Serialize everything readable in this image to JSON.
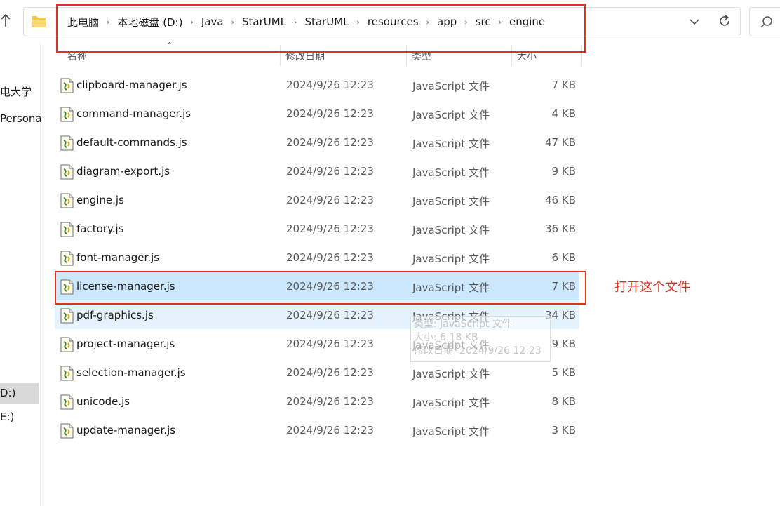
{
  "address_bar": {
    "breadcrumbs": [
      "此电脑",
      "本地磁盘 (D:)",
      "Java",
      "StarUML",
      "StarUML",
      "resources",
      "app",
      "src",
      "engine"
    ]
  },
  "nav": {
    "items": [
      {
        "label": "电大学",
        "selected": false
      },
      {
        "label": "Persona",
        "selected": false
      },
      {
        "label": "D:)",
        "selected": true
      },
      {
        "label": "E:)",
        "selected": false
      }
    ]
  },
  "columns": {
    "name": "名称",
    "date": "修改日期",
    "type": "类型",
    "size": "大小"
  },
  "files": [
    {
      "name": "clipboard-manager.js",
      "date": "2024/9/26 12:23",
      "type": "JavaScript 文件",
      "size": "7 KB"
    },
    {
      "name": "command-manager.js",
      "date": "2024/9/26 12:23",
      "type": "JavaScript 文件",
      "size": "4 KB"
    },
    {
      "name": "default-commands.js",
      "date": "2024/9/26 12:23",
      "type": "JavaScript 文件",
      "size": "47 KB"
    },
    {
      "name": "diagram-export.js",
      "date": "2024/9/26 12:23",
      "type": "JavaScript 文件",
      "size": "9 KB"
    },
    {
      "name": "engine.js",
      "date": "2024/9/26 12:23",
      "type": "JavaScript 文件",
      "size": "46 KB"
    },
    {
      "name": "factory.js",
      "date": "2024/9/26 12:23",
      "type": "JavaScript 文件",
      "size": "36 KB"
    },
    {
      "name": "font-manager.js",
      "date": "2024/9/26 12:23",
      "type": "JavaScript 文件",
      "size": "6 KB"
    },
    {
      "name": "license-manager.js",
      "date": "2024/9/26 12:23",
      "type": "JavaScript 文件",
      "size": "7 KB",
      "state": "selected"
    },
    {
      "name": "pdf-graphics.js",
      "date": "2024/9/26 12:23",
      "type": "JavaScript 文件",
      "size": "34 KB",
      "state": "hover"
    },
    {
      "name": "project-manager.js",
      "date": "2024/9/26 12:23",
      "type": "JavaScript 文件",
      "size": "9 KB"
    },
    {
      "name": "selection-manager.js",
      "date": "2024/9/26 12:23",
      "type": "JavaScript 文件",
      "size": "5 KB"
    },
    {
      "name": "unicode.js",
      "date": "2024/9/26 12:23",
      "type": "JavaScript 文件",
      "size": "8 KB"
    },
    {
      "name": "update-manager.js",
      "date": "2024/9/26 12:23",
      "type": "JavaScript 文件",
      "size": "3 KB"
    }
  ],
  "tooltip": {
    "lines": [
      "类型: JavaScript 文件",
      "大小: 6.18 KB",
      "修改日期: 2024/9/26 12:23"
    ]
  },
  "annotation": {
    "text": "打开这个文件",
    "color": "#e0301e"
  },
  "colors": {
    "selected_row": "#cce8ff",
    "hover_row": "#e5f3ff",
    "folder": "#f4c64c"
  }
}
